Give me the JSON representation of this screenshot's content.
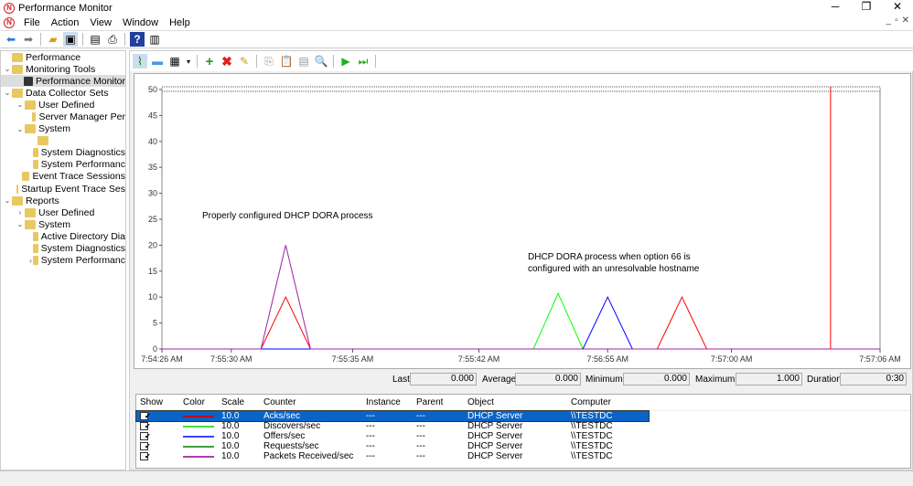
{
  "window": {
    "title": "Performance Monitor",
    "controls": [
      "─",
      "❐",
      "✕"
    ]
  },
  "menu": [
    "File",
    "Action",
    "View",
    "Window",
    "Help"
  ],
  "tree": [
    {
      "label": "Performance",
      "level": 0,
      "exp": ""
    },
    {
      "label": "Monitoring Tools",
      "level": 0,
      "exp": "⌄"
    },
    {
      "label": "Performance Monitor",
      "level": 1,
      "exp": "",
      "selected": true
    },
    {
      "label": "Data Collector Sets",
      "level": 0,
      "exp": "⌄"
    },
    {
      "label": "User Defined",
      "level": 1,
      "exp": "⌄"
    },
    {
      "label": "Server Manager Per",
      "level": 2,
      "exp": ""
    },
    {
      "label": "System",
      "level": 1,
      "exp": "⌄"
    },
    {
      "label": "",
      "level": 2,
      "exp": ""
    },
    {
      "label": "System Diagnostics",
      "level": 2,
      "exp": ""
    },
    {
      "label": "System Performanc",
      "level": 2,
      "exp": ""
    },
    {
      "label": "Event Trace Sessions",
      "level": 1,
      "exp": ""
    },
    {
      "label": "Startup Event Trace Ses",
      "level": 1,
      "exp": ""
    },
    {
      "label": "Reports",
      "level": 0,
      "exp": "⌄"
    },
    {
      "label": "User Defined",
      "level": 1,
      "exp": "›"
    },
    {
      "label": "System",
      "level": 1,
      "exp": "⌄"
    },
    {
      "label": "Active Directory Dia",
      "level": 2,
      "exp": ""
    },
    {
      "label": "System Diagnostics",
      "level": 2,
      "exp": ""
    },
    {
      "label": "System Performanc",
      "level": 2,
      "exp": "›"
    }
  ],
  "chart_data": {
    "type": "line",
    "ylim": [
      0,
      50
    ],
    "yticks": [
      0,
      5,
      10,
      15,
      20,
      25,
      30,
      35,
      40,
      45,
      50
    ],
    "xtick_labels": [
      "7:54:26 AM",
      "7:55:30 AM",
      "7:55:35 AM",
      "7:55:42 AM",
      "7:56:55 AM",
      "7:57:00 AM",
      "7:57:06 AM"
    ],
    "annotations": [
      "Properly configured DHCP DORA process",
      "DHCP DORA process when option 66 is",
      "configured with an unresolvable hostname"
    ],
    "samples": 30,
    "current_sample": 27,
    "series": [
      {
        "name": "Acks/sec",
        "color": "#ff0000",
        "values": [
          0,
          0,
          0,
          0,
          0,
          10,
          0,
          0,
          0,
          0,
          0,
          0,
          0,
          0,
          0,
          0,
          0,
          0,
          0,
          0,
          0,
          10,
          0,
          0,
          0,
          0,
          0,
          0,
          0,
          0
        ]
      },
      {
        "name": "Discovers/sec",
        "color": "#00ff00",
        "values": [
          0,
          0,
          0,
          0,
          0,
          0,
          0,
          0,
          0,
          0,
          0,
          0,
          0,
          0,
          0,
          0,
          10.7,
          0,
          0,
          0,
          0,
          0,
          0,
          0,
          0,
          0,
          0,
          0,
          0,
          0
        ]
      },
      {
        "name": "Offers/sec",
        "color": "#0000ff",
        "values": [
          0,
          0,
          0,
          0,
          0,
          0,
          0,
          0,
          0,
          0,
          0,
          0,
          0,
          0,
          0,
          0,
          0,
          0,
          10,
          0,
          0,
          0,
          0,
          0,
          0,
          0,
          0,
          0,
          0,
          0
        ]
      },
      {
        "name": "Requests/sec",
        "color": "#008000",
        "values": [
          0,
          0,
          0,
          0,
          0,
          0,
          0,
          0,
          0,
          0,
          0,
          0,
          0,
          0,
          0,
          0,
          0,
          0,
          0,
          0,
          0,
          0,
          0,
          0,
          0,
          0,
          0,
          0,
          0,
          0
        ]
      },
      {
        "name": "Packets Received/sec",
        "color": "#a020a0",
        "values": [
          0,
          0,
          0,
          0,
          0,
          20,
          0,
          0,
          0,
          0,
          0,
          0,
          0,
          0,
          0,
          0,
          0,
          0,
          0,
          0,
          0,
          0,
          0,
          0,
          0,
          0,
          0,
          0,
          0,
          0
        ]
      }
    ]
  },
  "stats": {
    "last_label": "Last",
    "last": "0.000",
    "avg_label": "Average",
    "avg": "0.000",
    "min_label": "Minimum",
    "min": "0.000",
    "max_label": "Maximum",
    "max": "1.000",
    "dur_label": "Duration",
    "dur": "0:30"
  },
  "table": {
    "headers": [
      "Show",
      "Color",
      "Scale",
      "Counter",
      "Instance",
      "Parent",
      "Object",
      "Computer"
    ],
    "rows": [
      {
        "show": "✔",
        "color": "#c00000",
        "scale": "10.0",
        "counter": "Acks/sec",
        "instance": "---",
        "parent": "---",
        "object": "DHCP Server",
        "computer": "\\\\TESTDC"
      },
      {
        "show": "✔",
        "color": "#40e040",
        "scale": "10.0",
        "counter": "Discovers/sec",
        "instance": "---",
        "parent": "---",
        "object": "DHCP Server",
        "computer": "\\\\TESTDC"
      },
      {
        "show": "✔",
        "color": "#4040ff",
        "scale": "10.0",
        "counter": "Offers/sec",
        "instance": "---",
        "parent": "---",
        "object": "DHCP Server",
        "computer": "\\\\TESTDC"
      },
      {
        "show": "✔",
        "color": "#40a040",
        "scale": "10.0",
        "counter": "Requests/sec",
        "instance": "---",
        "parent": "---",
        "object": "DHCP Server",
        "computer": "\\\\TESTDC"
      },
      {
        "show": "✔",
        "color": "#b040b0",
        "scale": "10.0",
        "counter": "Packets Received/sec",
        "instance": "---",
        "parent": "---",
        "object": "DHCP Server",
        "computer": "\\\\TESTDC"
      }
    ]
  }
}
